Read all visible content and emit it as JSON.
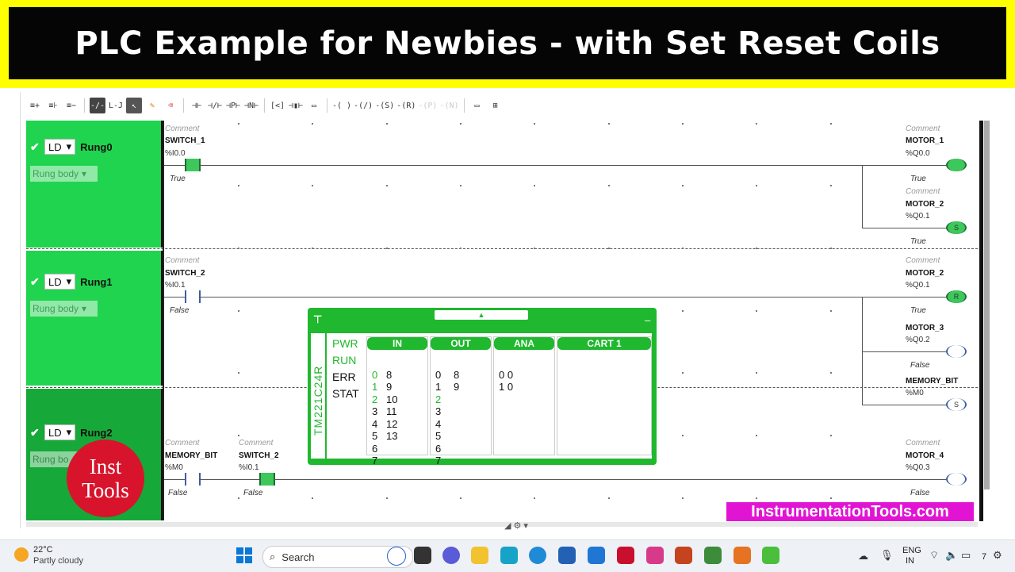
{
  "banner": {
    "title": "PLC Example for Newbies - with Set Reset Coils"
  },
  "toolbar": {
    "items": [
      "≡+",
      "≡⊦",
      "≡−",
      "-/-",
      "L-J",
      "↖",
      "✎",
      "⌫",
      "⊣⊢",
      "⊣/⊢",
      "⊣P⊢",
      "⊣N⊢",
      "[<]",
      "⊣▮⊢",
      "▭",
      "-( )",
      "-(/)",
      "-(S)",
      "-(R)",
      "-(P)",
      "-(N)",
      "▭",
      "⊞"
    ]
  },
  "rungs": [
    {
      "mode": "LD",
      "name": "Rung0",
      "body": "Rung body"
    },
    {
      "mode": "LD",
      "name": "Rung1",
      "body": "Rung body"
    },
    {
      "mode": "LD",
      "name": "Rung2",
      "body": "Rung bo"
    }
  ],
  "ladder": {
    "comment": "Comment",
    "r0": {
      "contact": {
        "tag": "SWITCH_1",
        "addr": "%I0.0",
        "state": "True"
      },
      "coil1": {
        "tag": "MOTOR_1",
        "addr": "%Q0.0",
        "state": "True"
      },
      "coil2": {
        "tag": "MOTOR_2",
        "addr": "%Q0.1",
        "state": "True",
        "symbol": "S"
      }
    },
    "r1": {
      "contact": {
        "tag": "SWITCH_2",
        "addr": "%I0.1",
        "state": "False"
      },
      "coil1": {
        "tag": "MOTOR_2",
        "addr": "%Q0.1",
        "state": "True",
        "symbol": "R"
      },
      "coil2": {
        "tag": "MOTOR_3",
        "addr": "%Q0.2",
        "state": "False"
      },
      "coil3": {
        "tag": "MEMORY_BIT",
        "addr": "%M0",
        "symbol": "S"
      }
    },
    "r2": {
      "contact1": {
        "tag": "MEMORY_BIT",
        "addr": "%M0",
        "state": "False"
      },
      "contact2": {
        "tag": "SWITCH_2",
        "addr": "%I0.1",
        "state": "False"
      },
      "coil1": {
        "tag": "MOTOR_4",
        "addr": "%Q0.3",
        "state": "False"
      }
    }
  },
  "plc": {
    "model": "TM221C24R",
    "status": [
      "PWR",
      "RUN",
      "ERR",
      "STAT"
    ],
    "headers": [
      "IN",
      "OUT",
      "ANA",
      "CART 1"
    ],
    "in_col1": [
      "0",
      "1",
      "2",
      "3",
      "4",
      "5",
      "6",
      "7"
    ],
    "in_col2": [
      "8",
      "9",
      "10",
      "11",
      "12",
      "13"
    ],
    "out_col1": [
      "0",
      "1",
      "2",
      "3",
      "4",
      "5",
      "6",
      "7"
    ],
    "out_col2": [
      "8",
      "9"
    ],
    "ana": [
      "0 0",
      "1 0"
    ]
  },
  "logo": {
    "line1": "Inst",
    "line2": "Tools"
  },
  "watermark": "InstrumentationTools.com",
  "taskbar": {
    "temp": "22°C",
    "weather": "Partly cloudy",
    "search": "Search",
    "lang1": "ENG",
    "lang2": "IN",
    "time": "7"
  },
  "colors": {
    "rung_green": "#21d44f",
    "plc_green": "#1fb82e",
    "banner_yellow": "#ffff00"
  }
}
